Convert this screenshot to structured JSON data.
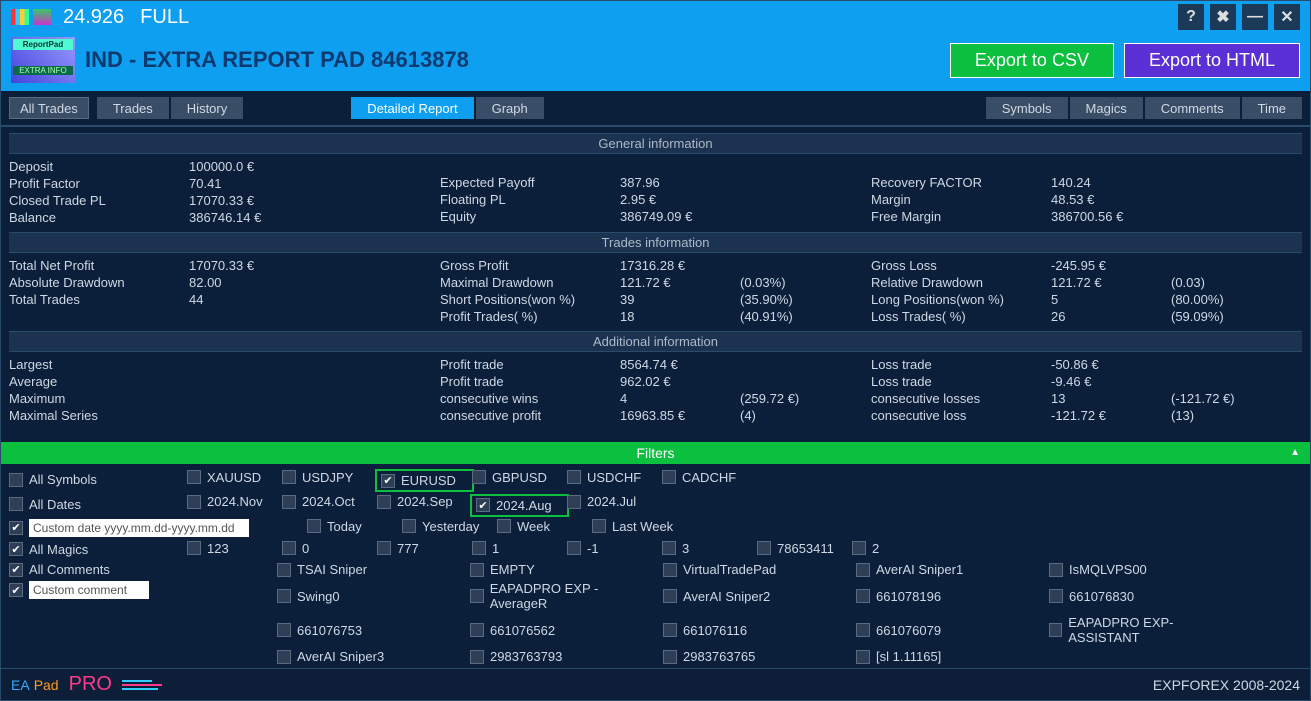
{
  "titlebar": {
    "version": "24.926",
    "mode": "FULL"
  },
  "header": {
    "logo_top": "ReportPad",
    "logo_bottom": "EXTRA INFO",
    "title": "IND - EXTRA REPORT PAD 84613878",
    "csv": "Export to CSV",
    "html": "Export to HTML"
  },
  "tabs": {
    "all_trades": "All Trades",
    "trades": "Trades",
    "history": "History",
    "detailed": "Detailed Report",
    "graph": "Graph",
    "symbols": "Symbols",
    "magics": "Magics",
    "comments": "Comments",
    "time": "Time"
  },
  "sections": {
    "general": {
      "head": "General information",
      "c1": [
        {
          "l": "Deposit",
          "v": "100000.0 €"
        },
        {
          "l": "Profit Factor",
          "v": "70.41"
        },
        {
          "l": "Closed Trade PL",
          "v": "17070.33 €"
        },
        {
          "l": "Balance",
          "v": "386746.14 €"
        }
      ],
      "c2": [
        {
          "l": "Expected Payoff",
          "v": "387.96"
        },
        {
          "l": "Floating PL",
          "v": "2.95 €"
        },
        {
          "l": "Equity",
          "v": "386749.09 €"
        }
      ],
      "c3": [
        {
          "l": "Recovery FACTOR",
          "v": "140.24"
        },
        {
          "l": "Margin",
          "v": "48.53 €"
        },
        {
          "l": "Free Margin",
          "v": "386700.56 €"
        }
      ]
    },
    "trades": {
      "head": "Trades information",
      "c1": [
        {
          "l": "Total Net Profit",
          "v": "17070.33 €"
        },
        {
          "l": "Absolute Drawdown",
          "v": "82.00"
        },
        {
          "l": "Total Trades",
          "v": "44"
        }
      ],
      "c2": [
        {
          "l": "Gross Profit",
          "v": "17316.28 €",
          "v2": ""
        },
        {
          "l": "Maximal Drawdown",
          "v": "121.72 €",
          "v2": "(0.03%)"
        },
        {
          "l": "Short Positions(won %)",
          "v": "39",
          "v2": "(35.90%)"
        },
        {
          "l": "Profit Trades( %)",
          "v": "18",
          "v2": "(40.91%)"
        }
      ],
      "c3": [
        {
          "l": "Gross Loss",
          "v": "-245.95 €",
          "v2": ""
        },
        {
          "l": "Relative Drawdown",
          "v": "121.72 €",
          "v2": "(0.03)"
        },
        {
          "l": "Long Positions(won %)",
          "v": "5",
          "v2": "(80.00%)"
        },
        {
          "l": "Loss Trades( %)",
          "v": "26",
          "v2": "(59.09%)"
        }
      ]
    },
    "addl": {
      "head": "Additional information",
      "c1": [
        {
          "l": "Largest"
        },
        {
          "l": "Average"
        },
        {
          "l": "Maximum"
        },
        {
          "l": "Maximal Series"
        }
      ],
      "c2": [
        {
          "l": "Profit trade",
          "v": "8564.74 €",
          "v2": ""
        },
        {
          "l": "Profit trade",
          "v": "962.02 €",
          "v2": ""
        },
        {
          "l": "consecutive wins",
          "v": "4",
          "v2": "(259.72 €)"
        },
        {
          "l": "consecutive profit",
          "v": "16963.85 €",
          "v2": "(4)"
        }
      ],
      "c3": [
        {
          "l": "Loss trade",
          "v": "-50.86 €",
          "v2": ""
        },
        {
          "l": "Loss trade",
          "v": "-9.46 €",
          "v2": ""
        },
        {
          "l": "consecutive losses",
          "v": "13",
          "v2": "(-121.72 €)"
        },
        {
          "l": "consecutive loss",
          "v": "-121.72 €",
          "v2": "(13)"
        }
      ]
    }
  },
  "filters": {
    "head": "Filters",
    "all_symbols": "All Symbols",
    "symbols": [
      "XAUUSD",
      "USDJPY",
      "EURUSD",
      "GBPUSD",
      "USDCHF",
      "CADCHF"
    ],
    "all_dates": "All Dates",
    "months": [
      "2024.Nov",
      "2024.Oct",
      "2024.Sep",
      "2024.Aug",
      "2024.Jul"
    ],
    "custom_date_ph": "Custom date yyyy.mm.dd-yyyy.mm.dd",
    "rel_dates": [
      "Today",
      "Yesterday",
      "Week",
      "Last Week"
    ],
    "all_magics": "All Magics",
    "magics": [
      "123",
      "0",
      "777",
      "1",
      "-1",
      "3",
      "78653411",
      "2"
    ],
    "all_comments": "All Comments",
    "custom_comment_ph": "Custom comment",
    "comments_grid": [
      [
        "TSAI Sniper",
        "EMPTY",
        "VirtualTradePad",
        "AverAI Sniper1",
        "IsMQLVPS00"
      ],
      [
        "Swing0",
        "EAPADPRO EXP - AverageR",
        "AverAI Sniper2",
        "661078196",
        "661076830"
      ],
      [
        "661076753",
        "661076562",
        "661076116",
        "661076079",
        "EAPADPRO EXP-ASSISTANT"
      ],
      [
        "AverAI Sniper3",
        "2983763793",
        "2983763765",
        "[sl 1.11165]",
        ""
      ]
    ]
  },
  "footer": {
    "ea": "EA",
    "pad": "Pad",
    "pro": "PRO",
    "copy": "EXPFOREX 2008-2024"
  }
}
